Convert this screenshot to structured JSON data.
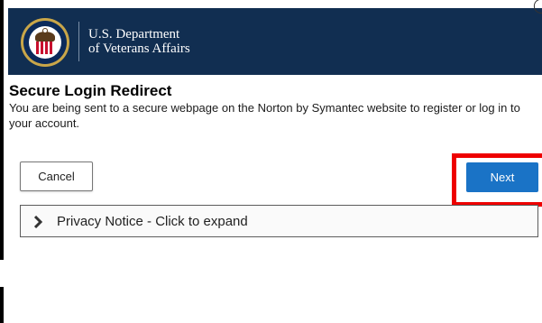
{
  "header": {
    "org_line1": "U.S. Department",
    "org_line2": "of Veterans Affairs",
    "seal_icon": "va-seal-icon",
    "bg_color": "#112e51"
  },
  "dialog": {
    "title": "Secure Login Redirect",
    "message": "You are being sent to a secure webpage on the Norton by Symantec website to register or log in to your account.",
    "cancel_label": "Cancel",
    "next_label": "Next",
    "next_color": "#1a73c6",
    "highlight_color": "#ee0000"
  },
  "privacy": {
    "label": "Privacy Notice - Click to expand",
    "icon": "chevron-right-icon"
  }
}
